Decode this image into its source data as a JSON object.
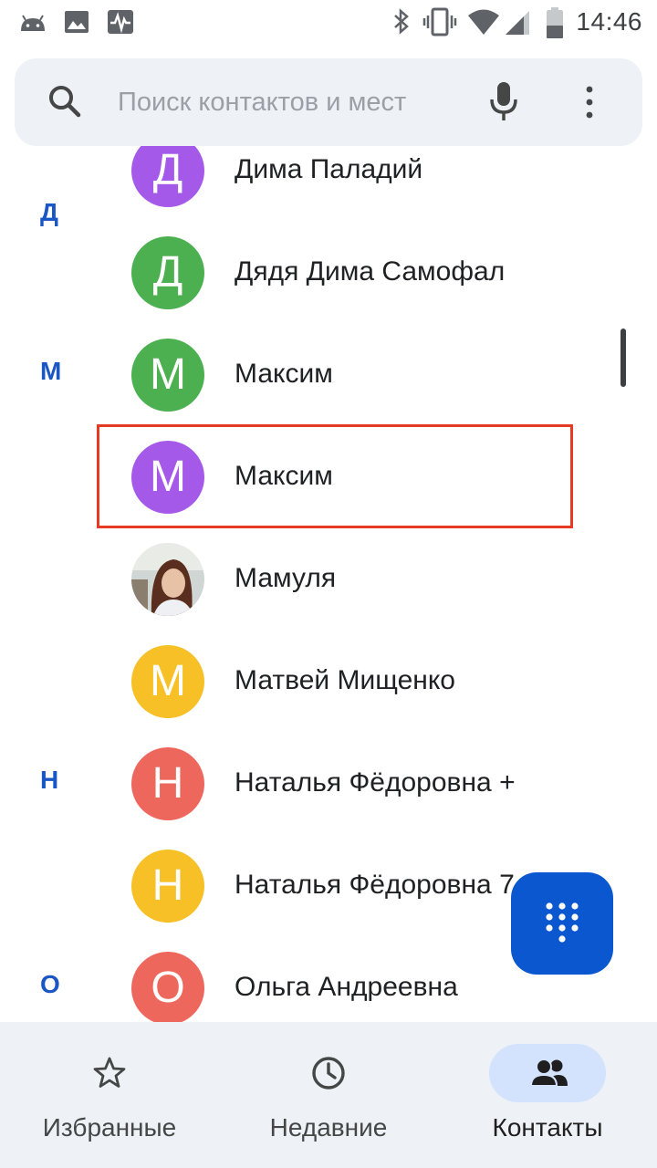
{
  "status_bar": {
    "time": "14:46",
    "left_icons": [
      "android-icon",
      "image-icon",
      "activity-icon"
    ],
    "right_icons": [
      "bluetooth-icon",
      "vibrate-icon",
      "wifi-icon",
      "signal-icon",
      "battery-icon"
    ]
  },
  "search": {
    "placeholder": "Поиск контактов и мест"
  },
  "contacts": [
    {
      "section": "",
      "name": "Дима Паладий",
      "initial": "Д",
      "color": "#a559e8"
    },
    {
      "section": "Д",
      "name": "Дядя Дима Самофал",
      "initial": "Д",
      "color": "#4caf50"
    },
    {
      "section": "М",
      "name": "Максим",
      "initial": "М",
      "color": "#4caf50"
    },
    {
      "section": "",
      "name": "Максим",
      "initial": "М",
      "color": "#a559e8",
      "highlighted": true
    },
    {
      "section": "",
      "name": "Мамуля",
      "initial": "",
      "photo": true
    },
    {
      "section": "",
      "name": "Матвей Мищенко",
      "initial": "М",
      "color": "#f6c026"
    },
    {
      "section": "Н",
      "name": "Наталья Фёдоровна +",
      "initial": "Н",
      "color": "#ee675c"
    },
    {
      "section": "",
      "name": "Наталья Фёдоровна 7",
      "initial": "Н",
      "color": "#f6c026"
    },
    {
      "section": "О",
      "name": "Ольга Андреевна",
      "initial": "О",
      "color": "#ee675c"
    }
  ],
  "nav": {
    "favorites": "Избранные",
    "recent": "Недавние",
    "contacts": "Контакты"
  },
  "colors": {
    "accent": "#0b57d0",
    "section_letter": "#1a56c4",
    "highlight_border": "#e53a23",
    "bottom_nav_bg": "#eef1f6"
  }
}
